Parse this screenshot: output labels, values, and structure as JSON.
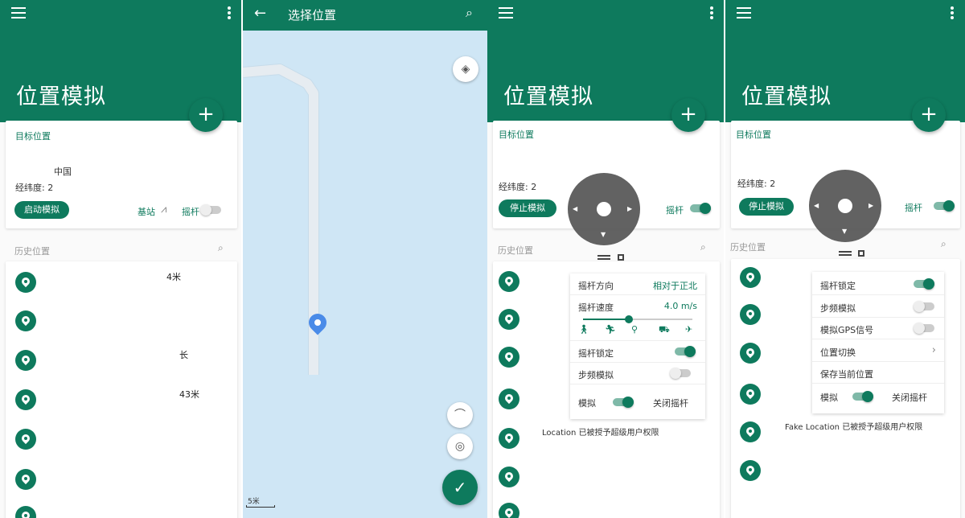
{
  "app": {
    "title": "位置模拟",
    "add_label": "+"
  },
  "panel1": {
    "target_label": "目标位置",
    "country": "中国",
    "coords_label": "经纬度: 2",
    "start_button": "启动模拟",
    "base_station": "基站",
    "joystick": "摇杆",
    "joystick_on": false,
    "history_label": "历史位置",
    "history": [
      {
        "text": "4米"
      },
      {
        "text": ""
      },
      {
        "text": "长"
      },
      {
        "text": "43米"
      },
      {
        "text": ""
      },
      {
        "text": ""
      },
      {
        "text": ""
      }
    ]
  },
  "map": {
    "title": "选择位置",
    "scale": "5米",
    "confirm": "✓"
  },
  "panel3": {
    "target_label": "目标位置",
    "coords_label": "经纬度: 2",
    "stop_button": "停止模拟",
    "joystick": "摇杆",
    "joystick_on": true,
    "history_label": "历史位置",
    "js_direction_label": "摇杆方向",
    "js_direction_value": "相对于正北",
    "js_speed_label": "摇杆速度",
    "js_speed_value": "4.0 m/s",
    "js_speed_fraction": 0.42,
    "js_lock_label": "摇杆锁定",
    "js_lock_on": true,
    "step_label": "步频模拟",
    "step_on": false,
    "sim_label": "模拟",
    "sim_on": true,
    "close_js": "关闭摇杆",
    "status_msg": "Location 已被授予超级用户权限"
  },
  "panel4": {
    "target_label": "目标位置",
    "coords_label": "经纬度: 2",
    "stop_button": "停止模拟",
    "joystick": "摇杆",
    "joystick_on": true,
    "history_label": "历史位置",
    "menu": [
      {
        "label": "摇杆锁定",
        "kind": "toggle",
        "on": true
      },
      {
        "label": "步频模拟",
        "kind": "toggle",
        "on": false
      },
      {
        "label": "模拟GPS信号",
        "kind": "toggle",
        "on": false
      },
      {
        "label": "位置切换",
        "kind": "chevron"
      },
      {
        "label": "保存当前位置",
        "kind": "none"
      }
    ],
    "sim_label": "模拟",
    "sim_on": true,
    "close_js": "关闭摇杆",
    "status_msg": "Fake Location 已被授予超级用户权限"
  },
  "colors": {
    "primary": "#0e7a5d",
    "map_water": "#cfe6f5",
    "pin_blue": "#4a8be8"
  }
}
